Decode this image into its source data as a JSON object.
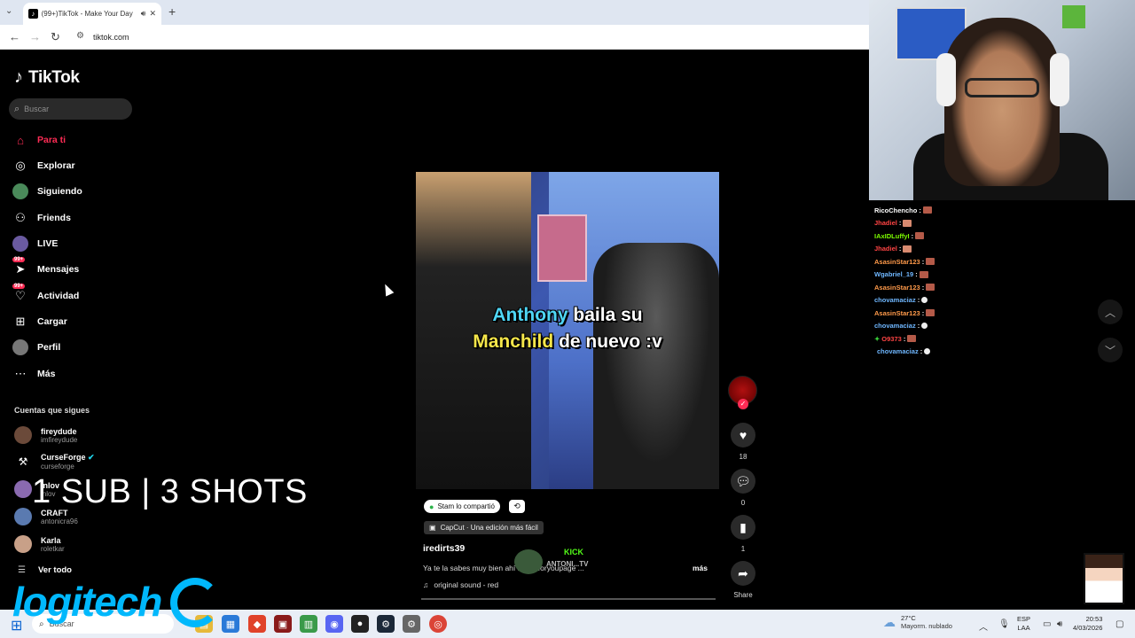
{
  "browser": {
    "tab_title": "(99+)TikTok - Make Your Day",
    "url": "tiktok.com"
  },
  "tiktok": {
    "logo": "TikTok",
    "search_placeholder": "Buscar",
    "nav": [
      {
        "label": "Para ti",
        "icon": "home-icon"
      },
      {
        "label": "Explorar",
        "icon": "compass-icon"
      },
      {
        "label": "Siguiendo",
        "icon": "following-icon"
      },
      {
        "label": "Friends",
        "icon": "friends-icon"
      },
      {
        "label": "LIVE",
        "icon": "live-icon"
      },
      {
        "label": "Mensajes",
        "icon": "messages-icon",
        "badge": "99+"
      },
      {
        "label": "Actividad",
        "icon": "activity-icon",
        "badge": "99+"
      },
      {
        "label": "Cargar",
        "icon": "upload-icon"
      },
      {
        "label": "Perfil",
        "icon": "profile-icon"
      },
      {
        "label": "Más",
        "icon": "more-icon"
      }
    ],
    "following_title": "Cuentas que sigues",
    "following": [
      {
        "name": "fireydude",
        "handle": "imfireydude"
      },
      {
        "name": "CurseForge",
        "handle": "curseforge"
      },
      {
        "name": "Inlov",
        "handle": "inlov"
      },
      {
        "name": "CRAFT",
        "handle": "antonicra96"
      },
      {
        "name": "Karla",
        "handle": "roletkar"
      }
    ],
    "see_all": "Ver todo"
  },
  "overlay": {
    "text": "1 SUB | 3 SHOTS",
    "brand": "logitech"
  },
  "video": {
    "caption_line1_a": "Anthony",
    "caption_line1_b": "baila su",
    "caption_line2_a": "Manchild",
    "caption_line2_b": "de nuevo :v",
    "shared": "Stam lo compartió",
    "capcut": "CapCut · Una edición más fácil",
    "author": "iredirts39",
    "description": "Ya te la sabes muy bien ahí #fyp #foryoupage ...",
    "more": "más",
    "sound": "original sound - red",
    "kick_label": "KICK",
    "kick_channel": "ANTONI...TV"
  },
  "actions": {
    "likes": "18",
    "comments": "0",
    "saves": "1",
    "share": "Share"
  },
  "chat": [
    {
      "user": "RicoChencho",
      "color": "#ffffff",
      "emote": "face"
    },
    {
      "user": "Jhadiel",
      "color": "#ff4444",
      "emote": "face-r"
    },
    {
      "user": "IAxIDLuffyI",
      "color": "#7cfc00",
      "emote": "face"
    },
    {
      "user": "Jhadiel",
      "color": "#ff4444",
      "emote": "face-r"
    },
    {
      "user": "AsasinStar123",
      "color": "#ff9a4a",
      "emote": "face"
    },
    {
      "user": "Wgabriel_19",
      "color": "#6fb7ff",
      "emote": "face"
    },
    {
      "user": "AsasinStar123",
      "color": "#ff9a4a",
      "emote": "face"
    },
    {
      "user": "chovamaciaz",
      "color": "#6fb7ff",
      "emote": "ghost"
    },
    {
      "user": "AsasinStar123",
      "color": "#ff9a4a",
      "emote": "face"
    },
    {
      "user": "chovamaciaz",
      "color": "#6fb7ff",
      "emote": "ghost"
    },
    {
      "user": "O9373",
      "color": "#ff4444",
      "emote": "face"
    },
    {
      "user": "chovamaciaz",
      "color": "#6fb7ff",
      "emote": "ghost"
    }
  ],
  "taskbar": {
    "search": "Buscar",
    "temp": "27°C",
    "weather": "Mayorm. nublado",
    "lang1": "ESP",
    "lang2": "LAA",
    "time": "20:53",
    "date": "4/03/2026"
  }
}
